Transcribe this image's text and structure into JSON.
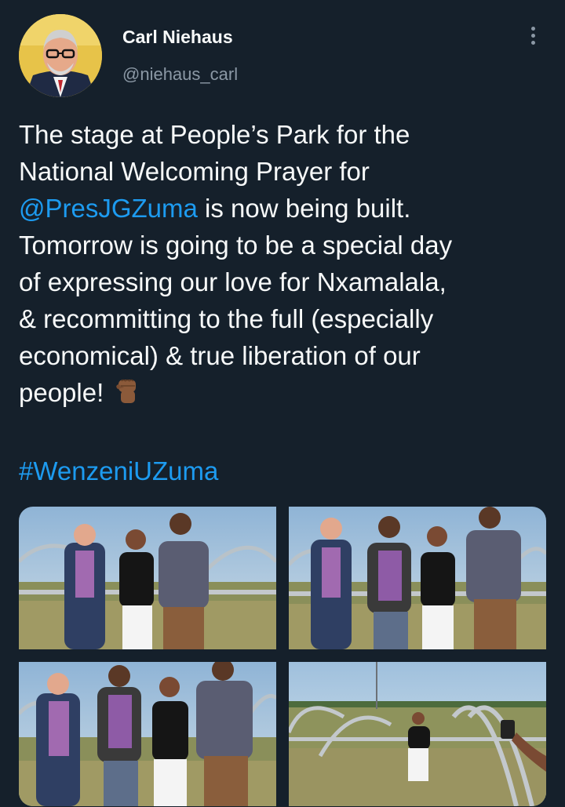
{
  "author": {
    "name": "Carl Niehaus",
    "handle": "@niehaus_carl"
  },
  "tweet": {
    "line1": "The stage at People’s Park for the",
    "line2": "National Welcoming Prayer for",
    "mention": "@PresJGZuma",
    "line3_rest": " is now being built.",
    "line4": "Tomorrow is going to be a special day",
    "line5": "of expressing our love for Nxamalala,",
    "line6": "& recommitting to the full (especially",
    "line7": "economical) & true liberation of our",
    "line8": "people!",
    "emoji": "raised-fist-emoji",
    "hashtag": "#WenzeniUZuma"
  },
  "colors": {
    "background": "#15202b",
    "text": "#f7f9f9",
    "secondary": "#8b98a5",
    "link": "#1d9bf0"
  },
  "icons": {
    "more": "more-vertical-icon"
  }
}
